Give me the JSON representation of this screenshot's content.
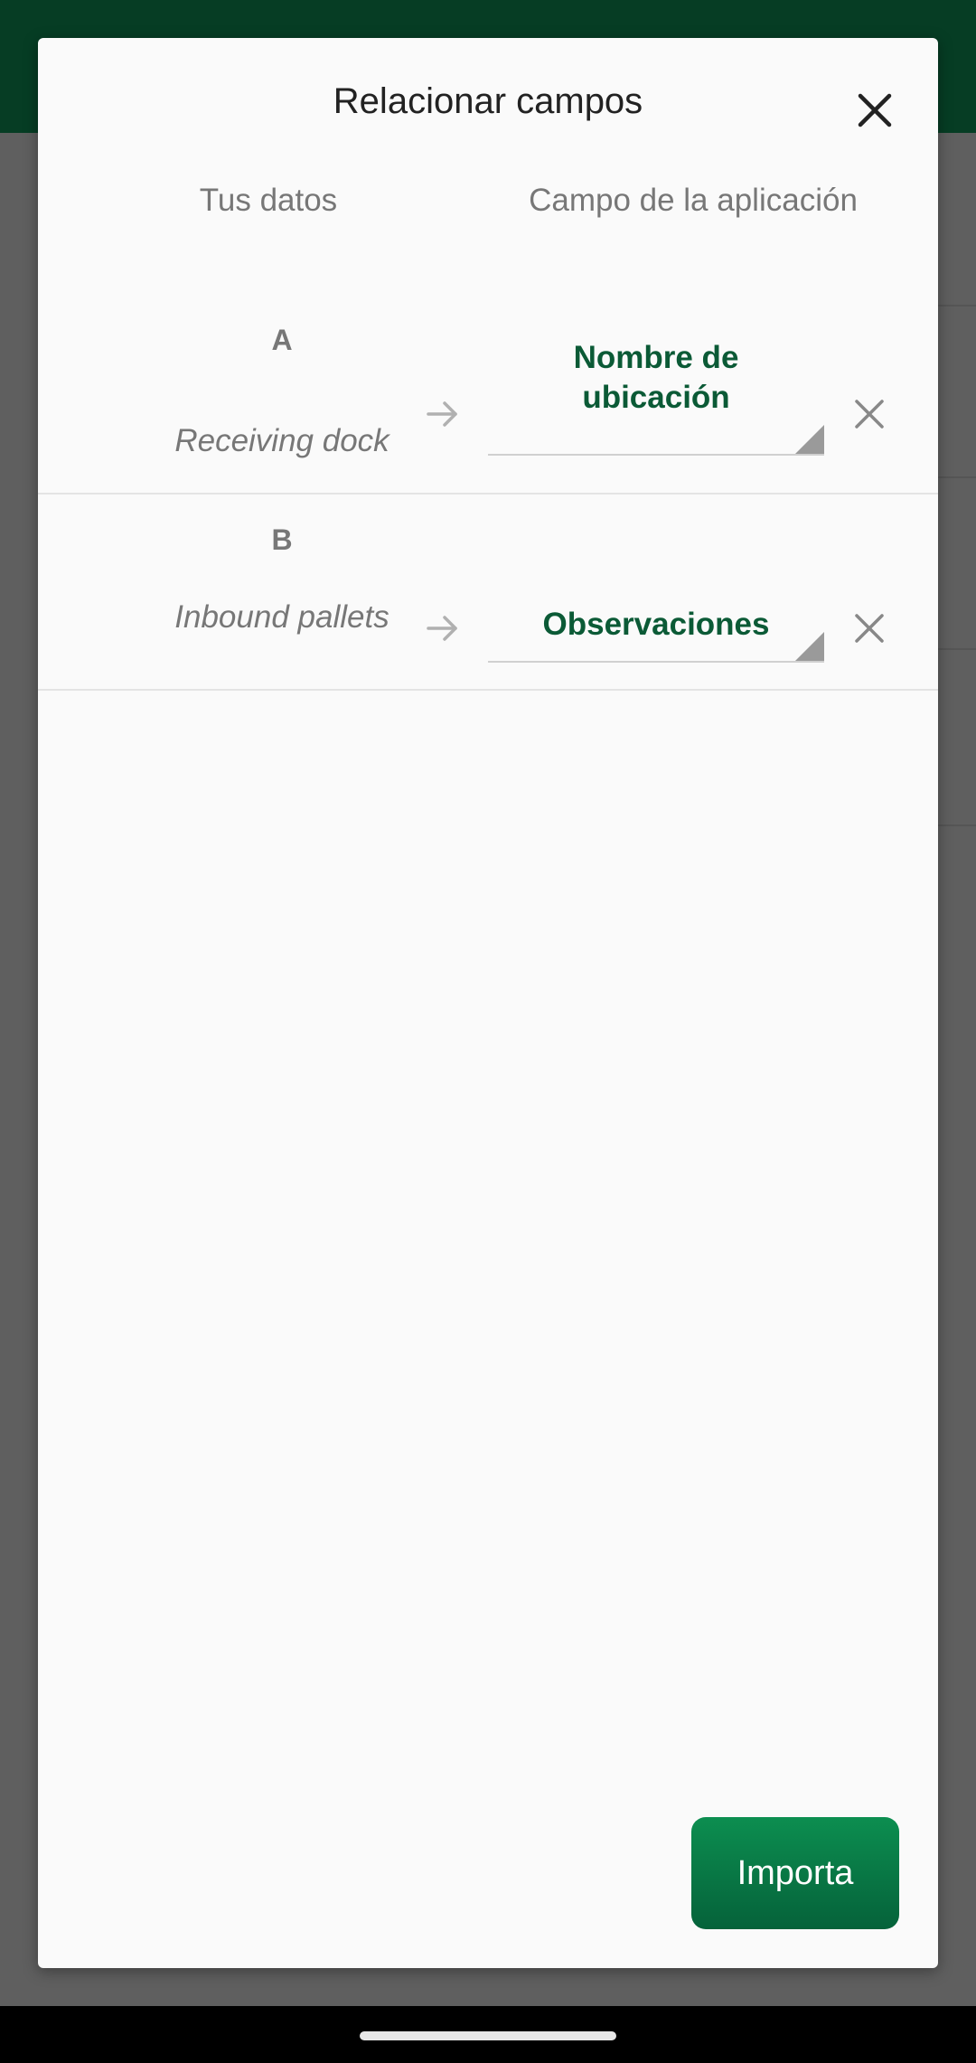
{
  "dialog": {
    "title": "Relacionar campos",
    "columns": {
      "left": "Tus datos",
      "right": "Campo de la aplicación"
    },
    "rows": [
      {
        "letter": "A",
        "sample": "Receiving dock",
        "field_line1": "Nombre de",
        "field_line2": "ubicación"
      },
      {
        "letter": "B",
        "sample": "Inbound pallets",
        "field_line1": "Observaciones",
        "field_line2": ""
      }
    ],
    "import_label": "Importa"
  },
  "icons": {
    "close": "close-icon",
    "arrow": "arrow-right-icon",
    "remove": "remove-x-icon",
    "dropdown": "dropdown-corner-icon"
  },
  "colors": {
    "header": "#063d24",
    "accent": "#0b5a36",
    "button": "#05623a",
    "scrim": "#5f5f5f"
  }
}
